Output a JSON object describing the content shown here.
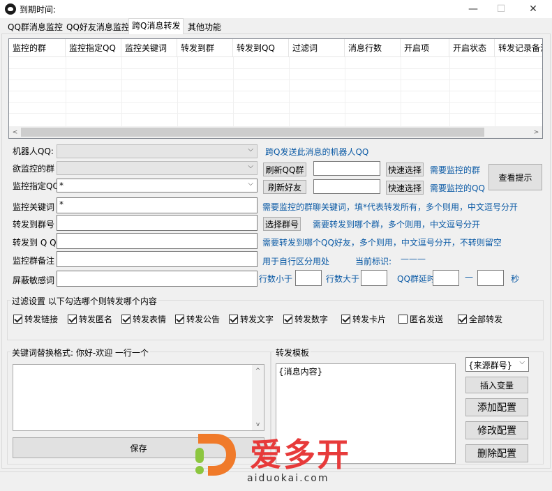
{
  "window": {
    "title": "到期时间:",
    "minimize": "—",
    "maximize": "☐",
    "close": "✕"
  },
  "tabs": [
    {
      "label": "QQ群消息监控"
    },
    {
      "label": "QQ好友消息监控"
    },
    {
      "label": "跨Q消息转发"
    },
    {
      "label": "其他功能"
    }
  ],
  "listview": {
    "columns": [
      "监控的群",
      "监控指定QQ",
      "监控关键词",
      "转发到群",
      "转发到QQ",
      "过滤词",
      "消息行数",
      "开启项",
      "开启状态",
      "转发记录备注"
    ]
  },
  "form": {
    "robot_qq_label": "机器人QQ:",
    "robot_qq_hint": "跨Q发送此消息的机器人QQ",
    "monitor_group_label": "欲监控的群",
    "refresh_group_btn": "刷新QQ群",
    "quick_select_btn_1": "快速选择",
    "monitor_group_hint": "需要监控的群",
    "view_tip_btn": "查看提示",
    "monitor_qq_label": "监控指定QQ",
    "monitor_qq_value": "*",
    "refresh_friend_btn": "刷新好友",
    "quick_select_btn_2": "快速选择",
    "monitor_qq_hint": "需要监控的QQ",
    "keyword_label": "监控关键词",
    "keyword_value": "*",
    "keyword_hint": "需要监控的群聊关键词，填*代表转发所有，多个则用，中文逗号分开",
    "forward_group_label": "转发到群号",
    "select_group_btn": "选择群号",
    "forward_group_hint": "需要转发到哪个群，多个则用，中文逗号分开",
    "forward_qq_label": "转发到 Q Q",
    "forward_qq_hint": "需要转发到哪个QQ好友，多个则用，中文逗号分开，不转则留空",
    "remark_label": "监控群备注",
    "remark_hint": "用于自行区分用处",
    "current_mark_label": "当前标识:",
    "current_mark_value": "———",
    "filter_word_label": "屏蔽敏感词",
    "lines_less_label": "行数小于",
    "lines_more_label": "行数大于",
    "delay_label": "QQ群延时",
    "dash": "—",
    "seconds": "秒"
  },
  "filter_group": {
    "title": "过滤设置  以下勾选哪个则转发哪个内容",
    "options": [
      {
        "label": "转发链接",
        "checked": true
      },
      {
        "label": "转发匿名",
        "checked": true
      },
      {
        "label": "转发表情",
        "checked": true
      },
      {
        "label": "转发公告",
        "checked": true
      },
      {
        "label": "转发文字",
        "checked": true
      },
      {
        "label": "转发数字",
        "checked": true
      },
      {
        "label": "转发卡片",
        "checked": true
      },
      {
        "label": "匿名发送",
        "checked": false
      },
      {
        "label": "全部转发",
        "checked": true
      }
    ]
  },
  "replace_group": {
    "title": "关键词替换格式: 你好-欢迎  一行一个",
    "save_btn": "保存"
  },
  "template_group": {
    "title": "转发模板",
    "content": "{消息内容}",
    "variable_select": "{来源群号}",
    "insert_var_btn": "插入变量",
    "add_config_btn": "添加配置",
    "edit_config_btn": "修改配置",
    "delete_config_btn": "删除配置"
  },
  "watermark": {
    "text": "爱多开",
    "url": "aiduokai.com"
  }
}
